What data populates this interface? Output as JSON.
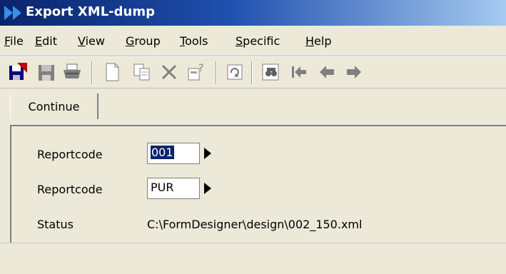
{
  "window": {
    "title": "Export XML-dump",
    "title_bar_colors": [
      "#0a246a",
      "#a6caf0"
    ]
  },
  "menu": [
    {
      "label": "File",
      "accel": "F",
      "rest": "ile"
    },
    {
      "label": "Edit",
      "accel": "E",
      "rest": "dit"
    },
    {
      "label": "View",
      "accel": "V",
      "rest": "iew"
    },
    {
      "label": "Group",
      "accel": "G",
      "rest": "roup"
    },
    {
      "label": "Tools",
      "accel": "T",
      "rest": "ools"
    },
    {
      "label": "Specific",
      "accel": "S",
      "rest": "pecific"
    },
    {
      "label": "Help",
      "accel": "H",
      "rest": "elp"
    }
  ],
  "toolbar": {
    "buttons": [
      "exit-icon",
      "save-icon",
      "print-icon",
      "new-icon",
      "copy-icon",
      "delete-icon",
      "properties-icon",
      "refresh-icon",
      "find-icon",
      "first-record-icon",
      "previous-record-icon",
      "next-record-icon"
    ]
  },
  "actions": {
    "continue_label": "Continue"
  },
  "form": {
    "reportcode1": {
      "label": "Reportcode",
      "value": "001"
    },
    "reportcode2": {
      "label": "Reportcode",
      "value": "PUR"
    },
    "status": {
      "label": "Status",
      "value": "C:\\FormDesigner\\design\\002_150.xml"
    }
  }
}
